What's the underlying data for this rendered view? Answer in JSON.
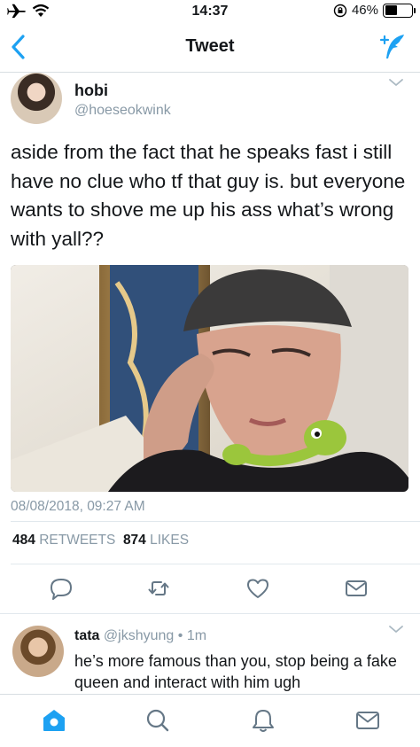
{
  "status_bar": {
    "time": "14:37",
    "battery_percent": "46%",
    "battery_level": 0.46,
    "icons": [
      "airplane-icon",
      "wifi-icon",
      "orientation-lock-icon",
      "battery-icon"
    ]
  },
  "nav": {
    "title": "Tweet",
    "back_icon": "chevron-left-icon",
    "compose_icon": "compose-tweet-icon"
  },
  "tweet": {
    "author_name": "hobi",
    "author_handle": "@hoeseokwink",
    "text": "aside from the fact that he speaks fast i still have no clue who tf that guy is. but everyone wants to shove me up his ass what’s wrong with yall??",
    "timestamp": "08/08/2018, 09:27 AM",
    "retweets_count": "484",
    "retweets_label": "RETWEETS",
    "likes_count": "874",
    "likes_label": "LIKES",
    "actions": [
      "reply-icon",
      "retweet-icon",
      "like-icon",
      "direct-message-icon"
    ]
  },
  "reply": {
    "author_name": "tata",
    "author_handle": "@jkshyung",
    "separator": "•",
    "time_ago": "1m",
    "text": "he’s more famous than you, stop being a fake queen and interact with him ugh"
  },
  "tab_bar": {
    "items": [
      "home-icon",
      "search-icon",
      "notifications-icon",
      "messages-icon"
    ]
  },
  "colors": {
    "accent": "#1da1f2",
    "muted": "#8899a6",
    "text": "#14171a",
    "divider": "#e1e8ed"
  }
}
